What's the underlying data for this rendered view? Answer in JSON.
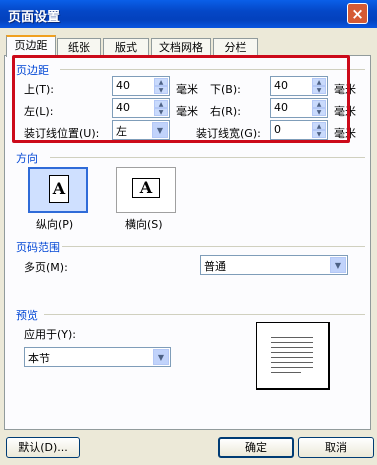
{
  "window": {
    "title": "页面设置",
    "close_glyph": "×"
  },
  "tabs": [
    {
      "label": "页边距",
      "active": true
    },
    {
      "label": "纸张",
      "active": false
    },
    {
      "label": "版式",
      "active": false
    },
    {
      "label": "文档网格",
      "active": false
    },
    {
      "label": "分栏",
      "active": false
    }
  ],
  "margins": {
    "section_title": "页边距",
    "top": {
      "label": "上(T):",
      "value": "40",
      "unit": "毫米"
    },
    "bottom": {
      "label": "下(B):",
      "value": "40",
      "unit": "毫米"
    },
    "left": {
      "label": "左(L):",
      "value": "40",
      "unit": "毫米"
    },
    "right": {
      "label": "右(R):",
      "value": "40",
      "unit": "毫米"
    },
    "gutter_position": {
      "label": "装订线位置(U):",
      "value": "左"
    },
    "gutter_width": {
      "label": "装订线宽(G):",
      "value": "0",
      "unit": "毫米"
    }
  },
  "orientation": {
    "section_title": "方向",
    "portrait": {
      "label": "纵向(P)",
      "glyph": "A",
      "selected": true
    },
    "landscape": {
      "label": "横向(S)",
      "glyph": "A",
      "selected": false
    }
  },
  "page_range": {
    "section_title": "页码范围",
    "multiple_pages": {
      "label": "多页(M):",
      "value": "普通"
    }
  },
  "preview": {
    "section_title": "预览",
    "apply_to": {
      "label": "应用于(Y):",
      "value": "本节"
    }
  },
  "buttons": {
    "default": "默认(D)...",
    "ok": "确定",
    "cancel": "取消"
  },
  "icons": {
    "spin_up": "▲",
    "spin_down": "▼",
    "dropdown": "▼"
  },
  "colors": {
    "titlebar": "#0447c7",
    "section_title": "#0046d5",
    "highlight_outline": "#cc0a1a",
    "active_tab_accent": "#f0a020"
  }
}
